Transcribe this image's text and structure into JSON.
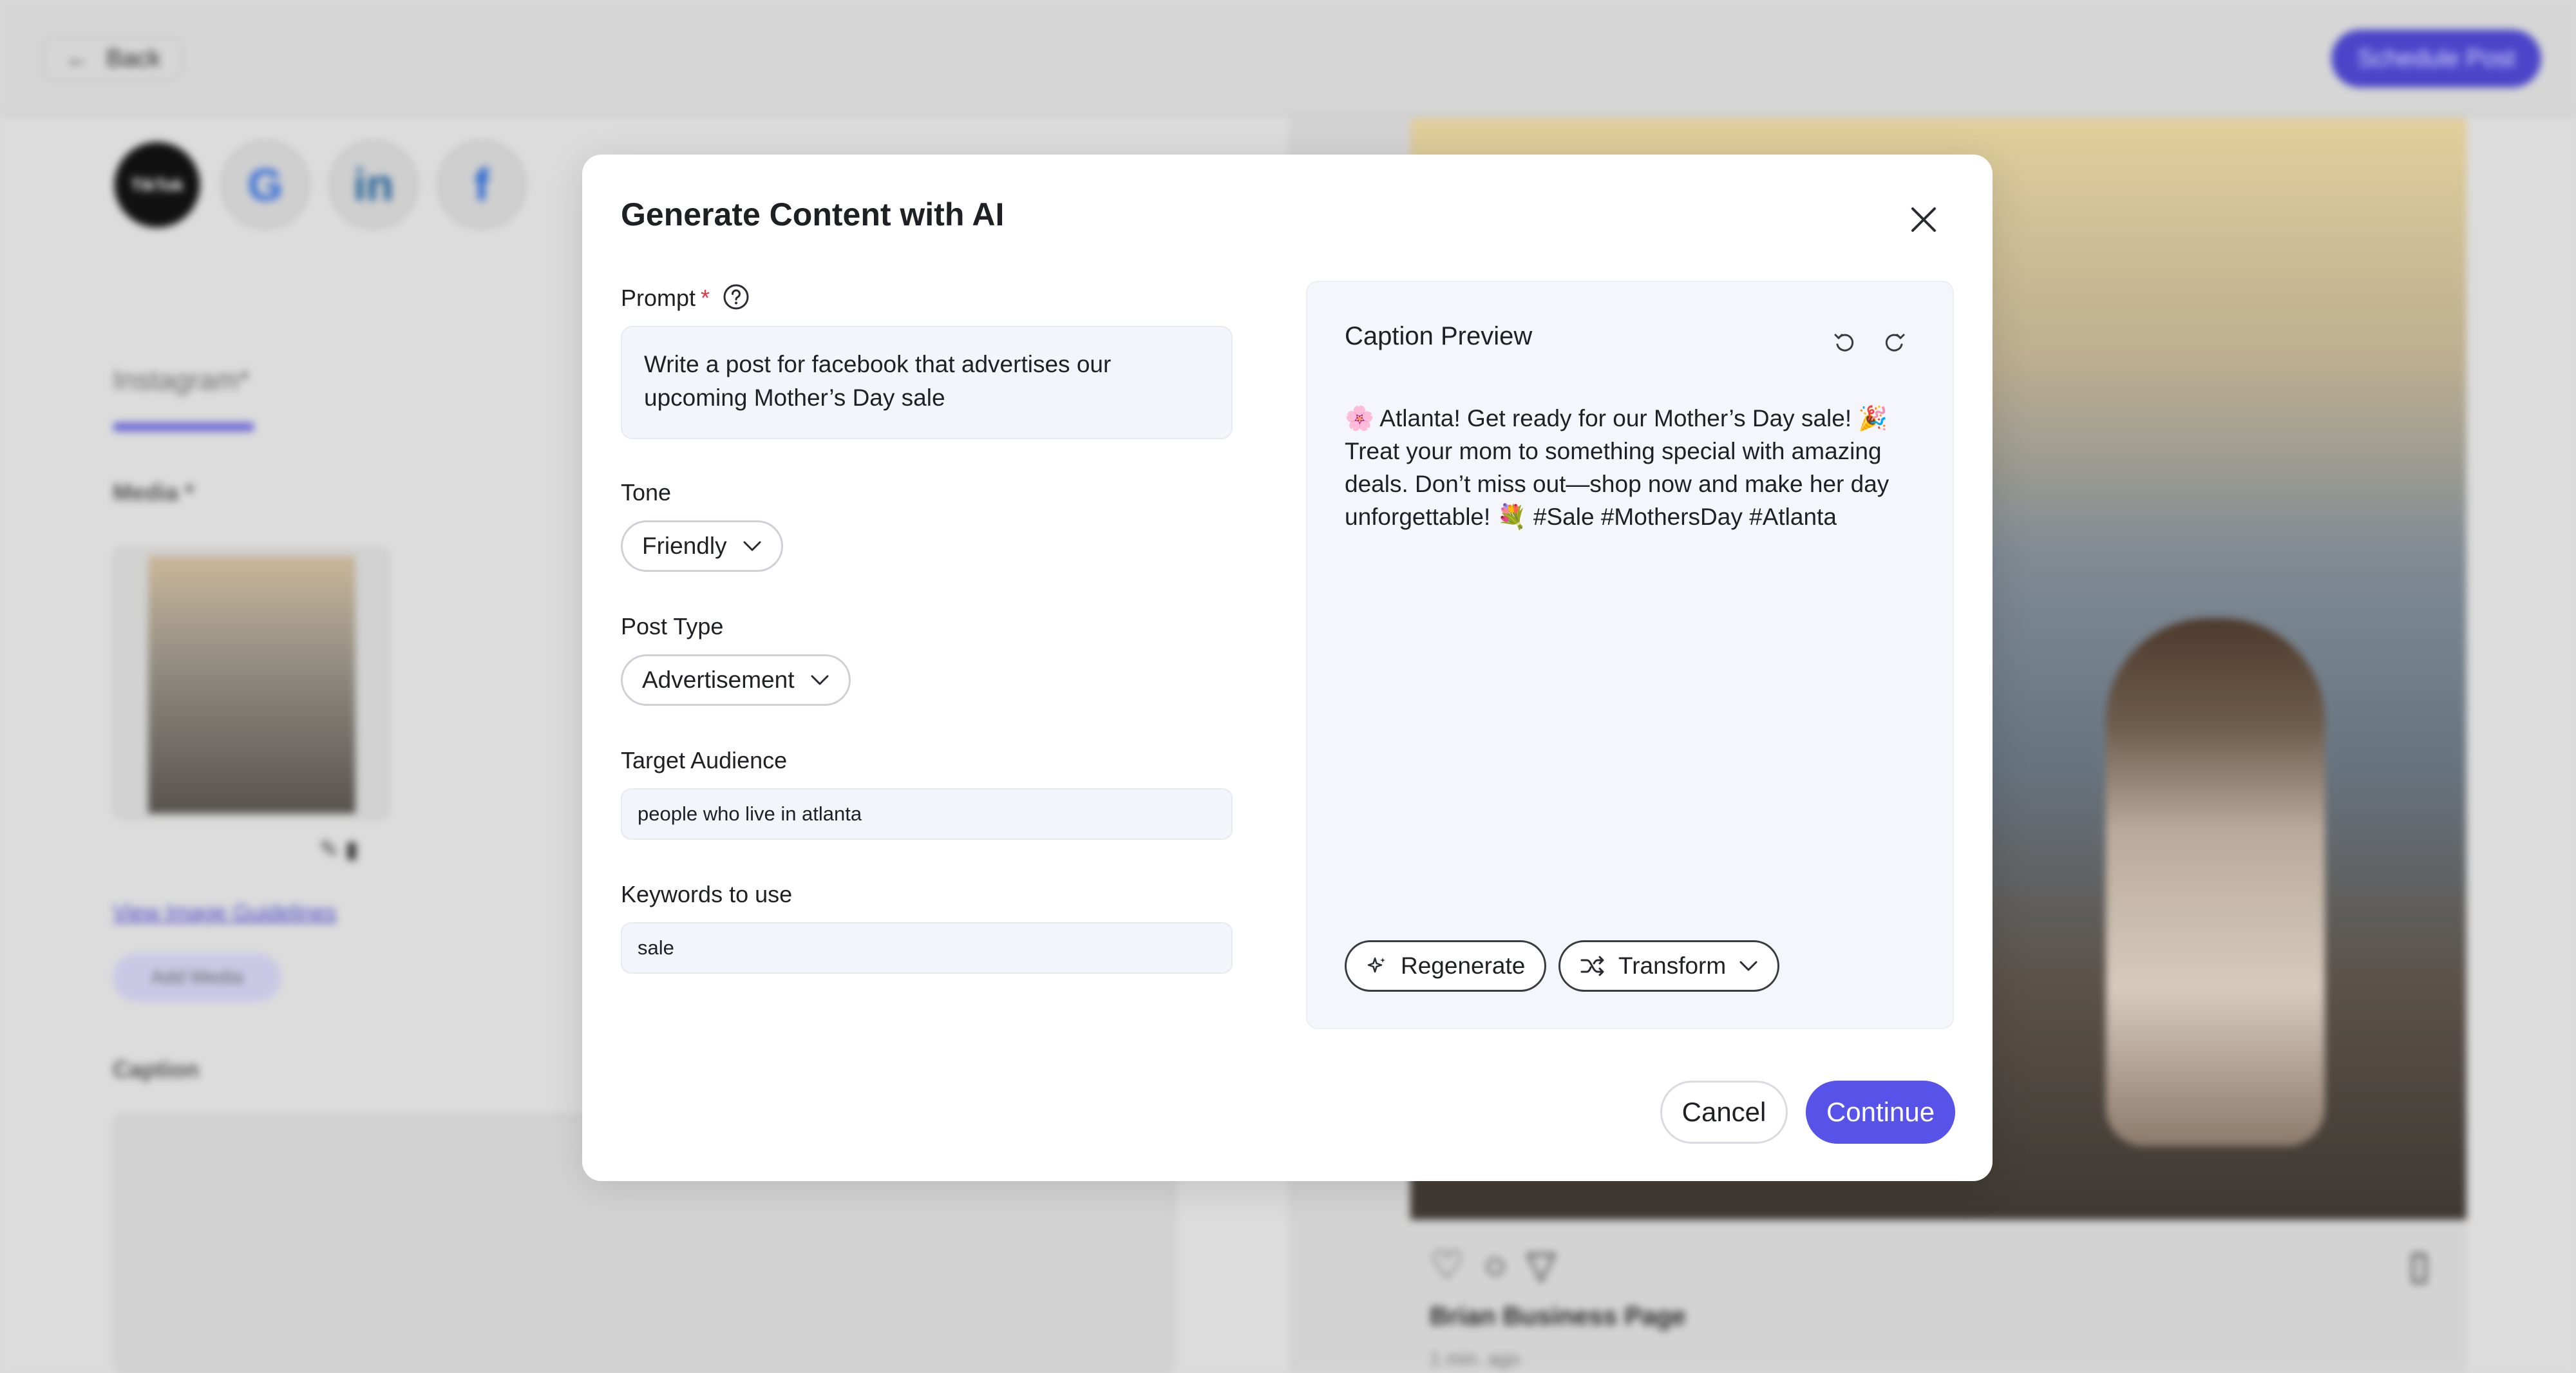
{
  "background": {
    "back_label": "Back",
    "schedule_label": "Schedule Post",
    "socials": [
      "TikTok",
      "G",
      "in",
      "f"
    ],
    "tab_label": "Instagram*",
    "media_label": "Media *",
    "guidelines_link": "View Image Guidelines",
    "add_media_label": "Add Media",
    "caption_label": "Caption",
    "page_name": "Brian Business Page",
    "post_time": "1 min. ago"
  },
  "modal": {
    "title": "Generate Content with AI",
    "prompt": {
      "label": "Prompt",
      "required_mark": "*",
      "value": "Write a post for facebook that advertises our upcoming Mother’s Day sale"
    },
    "tone": {
      "label": "Tone",
      "value": "Friendly"
    },
    "post_type": {
      "label": "Post Type",
      "value": "Advertisement"
    },
    "target_audience": {
      "label": "Target Audience",
      "value": "people who live in atlanta"
    },
    "keywords": {
      "label": "Keywords to use",
      "value": "sale"
    },
    "preview": {
      "title": "Caption Preview",
      "text": "🌸 Atlanta! Get ready for our Mother’s Day sale! 🎉 Treat your mom to something special with amazing deals. Don’t miss out—shop now and make her day unforgettable! 💐 #Sale #MothersDay #Atlanta",
      "regenerate_label": "Regenerate",
      "transform_label": "Transform"
    },
    "cancel_label": "Cancel",
    "continue_label": "Continue"
  },
  "colors": {
    "accent": "#5752e8",
    "required": "#e0384b",
    "input_bg": "#f4f5fa"
  }
}
